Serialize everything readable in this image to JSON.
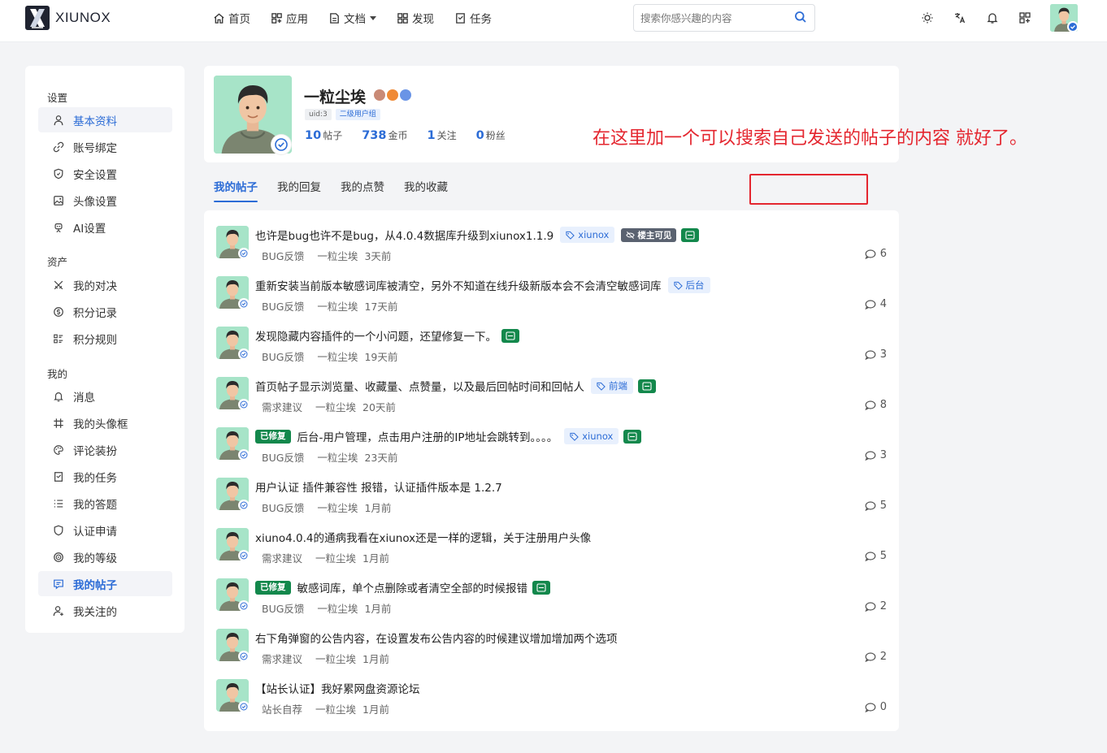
{
  "brand": {
    "name": "XIUNOX"
  },
  "nav": [
    {
      "label": "首页",
      "icon": "home-icon"
    },
    {
      "label": "应用",
      "icon": "apps-icon"
    },
    {
      "label": "文档",
      "icon": "doc-icon",
      "dropdown": true
    },
    {
      "label": "发现",
      "icon": "grid-icon"
    },
    {
      "label": "任务",
      "icon": "task-icon"
    }
  ],
  "search": {
    "placeholder": "搜索你感兴趣的内容"
  },
  "colors": {
    "accent": "#2c6cd6",
    "annotation": "#e4262f",
    "fixed_badge": "#13884c"
  },
  "sidebar": {
    "sections": [
      {
        "title": "设置",
        "items": [
          {
            "label": "基本资料",
            "icon": "user-icon",
            "active": true
          },
          {
            "label": "账号绑定",
            "icon": "link-icon"
          },
          {
            "label": "安全设置",
            "icon": "shield-icon"
          },
          {
            "label": "头像设置",
            "icon": "image-icon"
          },
          {
            "label": "AI设置",
            "icon": "robot-icon"
          }
        ]
      },
      {
        "title": "资产",
        "items": [
          {
            "label": "我的对决",
            "icon": "swords-icon"
          },
          {
            "label": "积分记录",
            "icon": "coin-icon"
          },
          {
            "label": "积分规则",
            "icon": "rules-icon"
          }
        ]
      },
      {
        "title": "我的",
        "items": [
          {
            "label": "消息",
            "icon": "bell-icon"
          },
          {
            "label": "我的头像框",
            "icon": "frame-icon"
          },
          {
            "label": "评论装扮",
            "icon": "palette-icon"
          },
          {
            "label": "我的任务",
            "icon": "task-icon"
          },
          {
            "label": "我的答题",
            "icon": "list-icon"
          },
          {
            "label": "认证申请",
            "icon": "badge-icon"
          },
          {
            "label": "我的等级",
            "icon": "level-icon"
          },
          {
            "label": "我的帖子",
            "icon": "post-icon",
            "current": true
          },
          {
            "label": "我关注的",
            "icon": "follow-icon"
          }
        ]
      }
    ]
  },
  "profile": {
    "name": "一粒尘埃",
    "uid": "uid:3",
    "group": "二级用户组",
    "stats": [
      {
        "value": "10",
        "unit": "帖子"
      },
      {
        "value": "738",
        "unit": "金币"
      },
      {
        "value": "1",
        "unit": "关注"
      },
      {
        "value": "0",
        "unit": "粉丝"
      }
    ]
  },
  "annotation": {
    "text": "在这里加一个可以搜索自己发送的帖子的内容 就好了。"
  },
  "tabs": [
    {
      "label": "我的帖子",
      "active": true
    },
    {
      "label": "我的回复"
    },
    {
      "label": "我的点赞"
    },
    {
      "label": "我的收藏"
    }
  ],
  "posts": [
    {
      "title": "也许是bug也许不是bug，从4.0.4数据库升级到xiunox1.1.9",
      "tag": "xiunox",
      "lock": "楼主可见",
      "gicon": true,
      "category": "BUG反馈",
      "author": "一粒尘埃",
      "time": "3天前",
      "comments": "6"
    },
    {
      "title": "重新安装当前版本敏感词库被清空，另外不知道在线升级新版本会不会清空敏感词库",
      "tag": "后台",
      "category": "BUG反馈",
      "author": "一粒尘埃",
      "time": "17天前",
      "comments": "4"
    },
    {
      "title": "发现隐藏内容插件的一个小问题，还望修复一下。",
      "gicon": true,
      "category": "BUG反馈",
      "author": "一粒尘埃",
      "time": "19天前",
      "comments": "3"
    },
    {
      "title": "首页帖子显示浏览量、收藏量、点赞量，以及最后回帖时间和回帖人",
      "tag": "前端",
      "gicon": true,
      "category": "需求建议",
      "author": "一粒尘埃",
      "time": "20天前",
      "comments": "8"
    },
    {
      "fixed": "已修复",
      "title": "后台-用户管理，点击用户注册的IP地址会跳转到。。。。",
      "tag": "xiunox",
      "gicon": true,
      "category": "BUG反馈",
      "author": "一粒尘埃",
      "time": "23天前",
      "comments": "3"
    },
    {
      "title": "用户认证 插件兼容性 报错，认证插件版本是 1.2.7",
      "category": "BUG反馈",
      "author": "一粒尘埃",
      "time": "1月前",
      "comments": "5"
    },
    {
      "title": "xiuno4.0.4的通病我看在xiunox还是一样的逻辑，关于注册用户头像",
      "category": "需求建议",
      "author": "一粒尘埃",
      "time": "1月前",
      "comments": "5"
    },
    {
      "fixed": "已修复",
      "title": "敏感词库，单个点删除或者清空全部的时候报错",
      "gicon": true,
      "category": "BUG反馈",
      "author": "一粒尘埃",
      "time": "1月前",
      "comments": "2"
    },
    {
      "title": "右下角弹窗的公告内容，在设置发布公告内容的时候建议增加增加两个选项",
      "category": "需求建议",
      "author": "一粒尘埃",
      "time": "1月前",
      "comments": "2"
    },
    {
      "title": "【站长认证】我好累网盘资源论坛",
      "category": "站长自荐",
      "author": "一粒尘埃",
      "time": "1月前",
      "comments": "0"
    }
  ]
}
